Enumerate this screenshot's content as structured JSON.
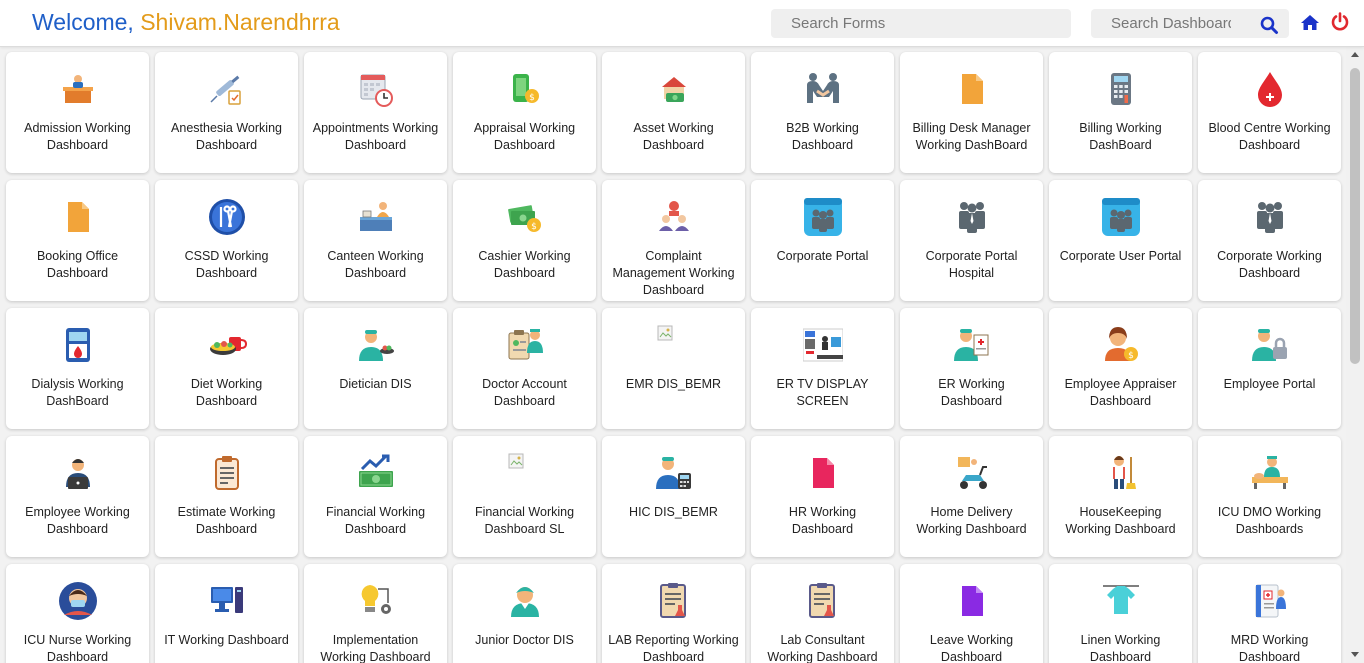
{
  "header": {
    "welcome_prefix": "Welcome,",
    "user_name": "Shivam.Narendhrra",
    "search_forms_placeholder": "Search Forms",
    "search_dashboards_placeholder": "Search Dashboards"
  },
  "colors": {
    "welcome": "#1f5fc8",
    "user_name": "#e39b1a",
    "search_icon": "#1a33c9",
    "home_icon": "#1a33c9",
    "power_icon": "#e0282e"
  },
  "tiles": [
    {
      "label": "Admission Working Dashboard",
      "icon": "admission-desk"
    },
    {
      "label": "Anesthesia Working Dashboard",
      "icon": "syringe"
    },
    {
      "label": "Appointments Working Dashboard",
      "icon": "calendar-clock"
    },
    {
      "label": "Appraisal Working Dashboard",
      "icon": "phone-money"
    },
    {
      "label": "Asset Working Dashboard",
      "icon": "house-money"
    },
    {
      "label": "B2B Working Dashboard",
      "icon": "handshake"
    },
    {
      "label": "Billing Desk Manager Working DashBoard",
      "icon": "document"
    },
    {
      "label": "Billing Working DashBoard",
      "icon": "calculator"
    },
    {
      "label": "Blood Centre Working Dashboard",
      "icon": "blood-drop"
    },
    {
      "label": "Booking Office Dashboard",
      "icon": "document"
    },
    {
      "label": "CSSD Working Dashboard",
      "icon": "surgical-tools"
    },
    {
      "label": "Canteen Working Dashboard",
      "icon": "canteen-counter"
    },
    {
      "label": "Cashier Working Dashboard",
      "icon": "cash-coins"
    },
    {
      "label": "Complaint Management Working Dashboard",
      "icon": "complaint-people"
    },
    {
      "label": "Corporate Portal",
      "icon": "corporate-portal"
    },
    {
      "label": "Corporate Portal Hospital",
      "icon": "business-people"
    },
    {
      "label": "Corporate User Portal",
      "icon": "corporate-portal"
    },
    {
      "label": "Corporate Working Dashboard",
      "icon": "business-people"
    },
    {
      "label": "Dialysis Working DashBoard",
      "icon": "dialysis-machine"
    },
    {
      "label": "Diet Working Dashboard",
      "icon": "diet-food"
    },
    {
      "label": "Dietician DIS",
      "icon": "doctor-food"
    },
    {
      "label": "Doctor Account Dashboard",
      "icon": "doctor-clipboard"
    },
    {
      "label": "EMR DIS_BEMR",
      "icon": "broken-image"
    },
    {
      "label": "ER TV DISPLAY SCREEN",
      "icon": "tv-display"
    },
    {
      "label": "ER Working Dashboard",
      "icon": "doctor-chart"
    },
    {
      "label": "Employee Appraiser Dashboard",
      "icon": "employee-coin"
    },
    {
      "label": "Employee Portal",
      "icon": "doctor-lock"
    },
    {
      "label": "Employee Working Dashboard",
      "icon": "employee-laptop"
    },
    {
      "label": "Estimate Working Dashboard",
      "icon": "clipboard"
    },
    {
      "label": "Financial Working Dashboard",
      "icon": "money-chart"
    },
    {
      "label": "Financial Working Dashboard SL",
      "icon": "broken-image"
    },
    {
      "label": "HIC DIS_BEMR",
      "icon": "doctor-calculator"
    },
    {
      "label": "HR Working Dashboard",
      "icon": "document-pink"
    },
    {
      "label": "Home Delivery Working Dashboard",
      "icon": "delivery-scooter"
    },
    {
      "label": "HouseKeeping Working Dashboard",
      "icon": "housekeeper"
    },
    {
      "label": "ICU DMO Working Dashboards",
      "icon": "icu-bed"
    },
    {
      "label": "ICU Nurse Working Dashboard",
      "icon": "nurse-avatar"
    },
    {
      "label": "IT Working Dashboard",
      "icon": "computer"
    },
    {
      "label": "Implementation Working Dashboard",
      "icon": "lightbulb-gear"
    },
    {
      "label": "Junior Doctor DIS",
      "icon": "junior-doctor"
    },
    {
      "label": "LAB Reporting Working Dashboard",
      "icon": "lab-report"
    },
    {
      "label": "Lab Consultant Working Dashboard",
      "icon": "lab-report"
    },
    {
      "label": "Leave Working Dashboard",
      "icon": "document-purple"
    },
    {
      "label": "Linen Working Dashboard",
      "icon": "linen-shirt"
    },
    {
      "label": "MRD Working Dashboard",
      "icon": "medical-record"
    }
  ]
}
